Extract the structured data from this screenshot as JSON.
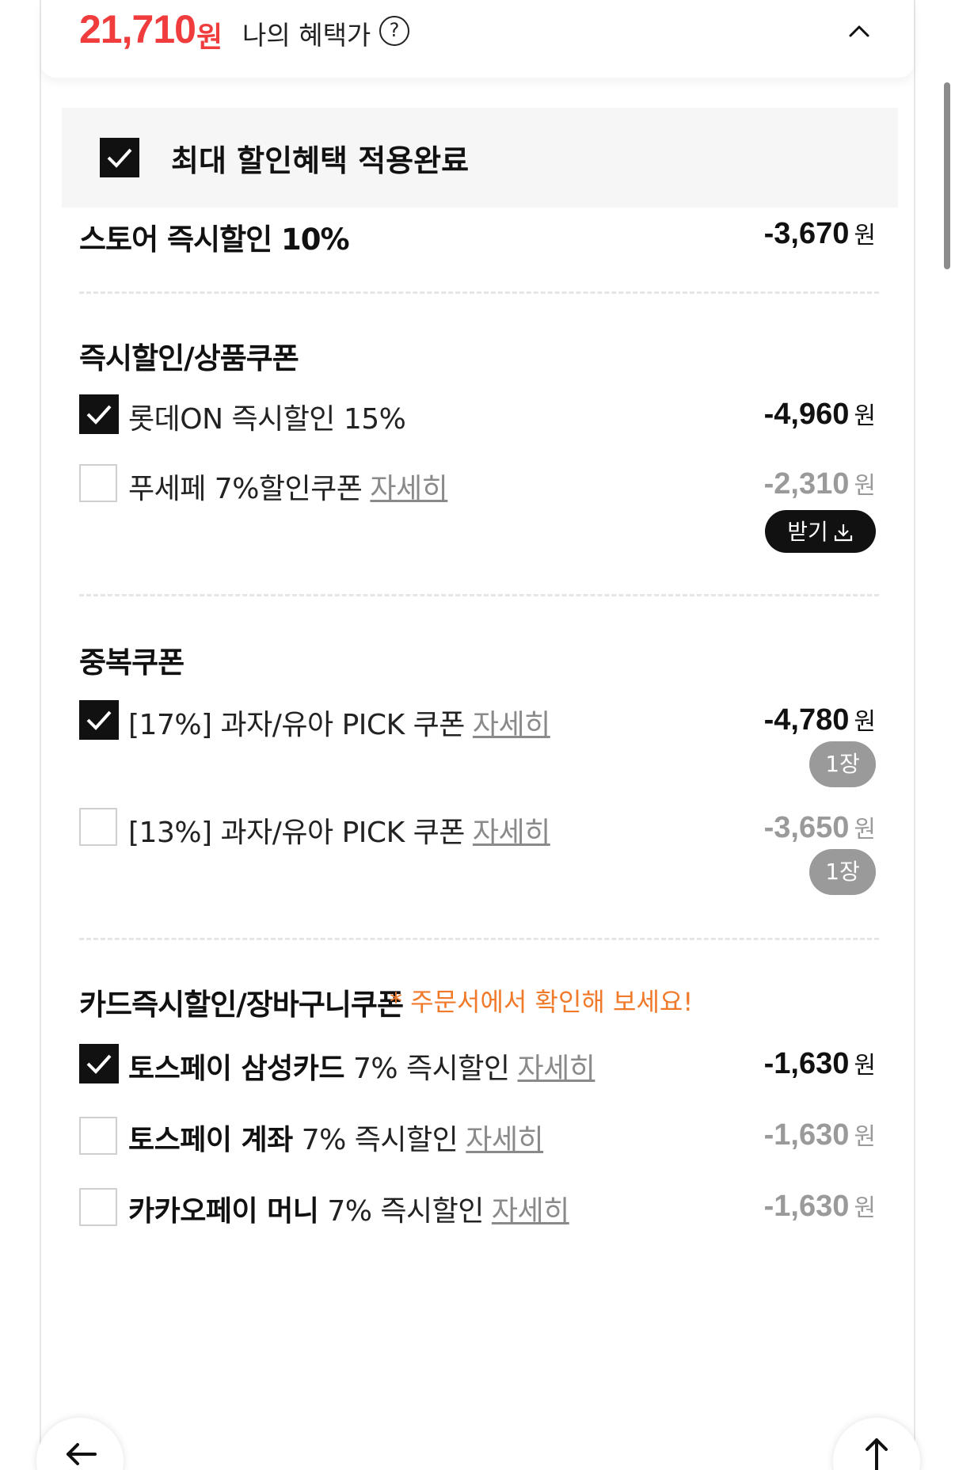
{
  "header": {
    "price": "21,710",
    "price_unit": "원",
    "label": "나의 혜택가",
    "help_glyph": "?",
    "toggle_icon": "chevron-up-icon"
  },
  "banner": {
    "text": "최대 할인혜택 적용완료",
    "checked": true
  },
  "store_discount": {
    "title": "스토어 즉시할인 10%",
    "amount": "-3,670",
    "unit": "원"
  },
  "instant_coupons": {
    "title": "즉시할인/상품쿠폰",
    "items": [
      {
        "label": "롯데ON 즉시할인 15%",
        "link": "",
        "amount": "-4,960",
        "unit": "원",
        "checked": true
      },
      {
        "label": "푸세페 7%할인쿠폰",
        "link": "자세히",
        "amount": "-2,310",
        "unit": "원",
        "checked": false,
        "button": "받기"
      }
    ]
  },
  "duplicate_coupons": {
    "title": "중복쿠폰",
    "items": [
      {
        "label": "[17%] 과자/유아 PICK 쿠폰",
        "link": "자세히",
        "amount": "-4,780",
        "unit": "원",
        "checked": true,
        "badge": "1장"
      },
      {
        "label": "[13%] 과자/유아 PICK 쿠폰",
        "link": "자세히",
        "amount": "-3,650",
        "unit": "원",
        "checked": false,
        "badge": "1장"
      }
    ]
  },
  "card_discounts": {
    "title": "카드즉시할인/장바구니쿠폰",
    "notice": "* 주문서에서 확인해 보세요!",
    "items": [
      {
        "label_bold": "토스페이 삼성카드",
        "label": "7% 즉시할인",
        "link": "자세히",
        "amount": "-1,630",
        "unit": "원",
        "checked": true
      },
      {
        "label_bold": "토스페이 계좌",
        "label": "7% 즉시할인",
        "link": "자세히",
        "amount": "-1,630",
        "unit": "원",
        "checked": false
      },
      {
        "label_bold": "카카오페이 머니",
        "label": "7% 즉시할인",
        "link": "자세히",
        "amount": "-1,630",
        "unit": "원",
        "checked": false
      }
    ]
  },
  "fabs": {
    "back_icon": "arrow-left-icon",
    "top_icon": "arrow-up-icon"
  },
  "colors": {
    "price_red": "#f03c3c",
    "notice_orange": "#f07a2a",
    "check_black": "#111111",
    "dim_gray": "#9a9a9a"
  }
}
